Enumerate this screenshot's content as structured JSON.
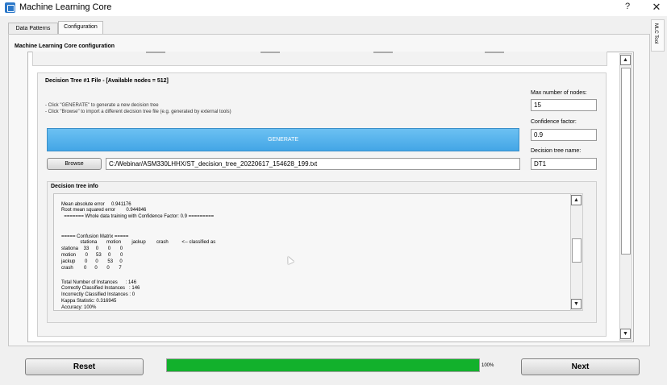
{
  "window": {
    "title": "Machine Learning Core",
    "help": "?",
    "close": "✕"
  },
  "tabs": [
    "Data Patterns",
    "Configuration"
  ],
  "side_tab": "MLC Tool",
  "config_header": "Machine Learning Core configuration",
  "decision_tree": {
    "title": "Decision Tree #1 File   -   [Available nodes = 512]",
    "hint1": "- Click \"GENERATE\" to generate a new decision tree",
    "hint2": "- Click \"Browse\" to import a different decision tree file (e.g. generated by external tools)",
    "generate_label": "GENERATE",
    "browse_label": "Browse",
    "file_path": "C:/Webinar/ASM330LHHX/ST_decision_tree_20220617_154628_199.txt",
    "max_nodes_label": "Max number of nodes:",
    "max_nodes_value": "15",
    "confidence_label": "Confidence factor:",
    "confidence_value": "0.9",
    "tree_name_label": "Decision tree name:",
    "tree_name_value": "DT1"
  },
  "info": {
    "title": "Decision tree info",
    "lines": [
      "Mean absolute error     0.941176",
      "Root mean squared error        0.944846",
      "  ======= Whole data training with Confidence Factor: 0.9 =========",
      "",
      "",
      "===== Confusion Matrix =====",
      "              stationa       motion        jackup        crash          <-- classified as",
      "stationa    33     0       0       0",
      "motion       0      53     0       0",
      "jackup       0      0       53     0",
      "crash        0      0       0       7",
      "",
      "Total Number of Instances      : 146",
      "Correctly Classified Instances   : 146",
      "Incorrectly Classified Instances : 0",
      "Kappa Statistic: 0.316945",
      "Accuracy: 100%"
    ]
  },
  "footer": {
    "reset_label": "Reset",
    "next_label": "Next",
    "progress_value": 100,
    "progress_label": "100%"
  },
  "colors": {
    "generate": "#43a6e6",
    "progress": "#12b12c",
    "app_icon": "#2c78c9"
  }
}
